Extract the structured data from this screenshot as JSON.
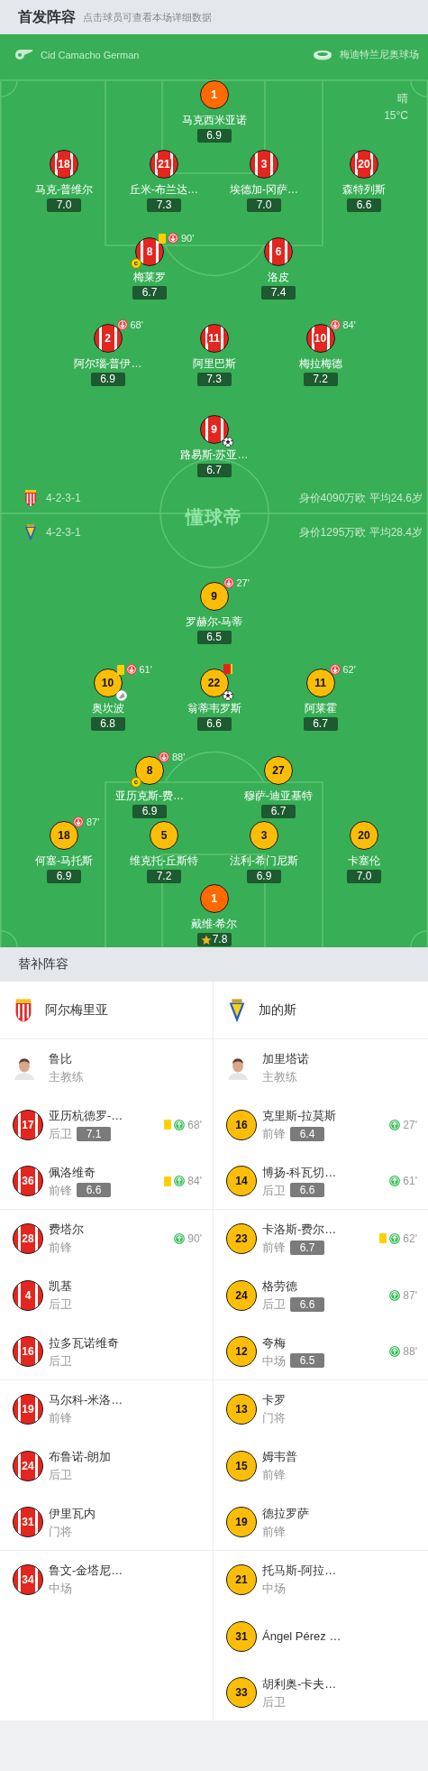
{
  "header": {
    "title": "首发阵容",
    "subtitle": "点击球员可查看本场详细数据"
  },
  "match": {
    "referee": "Cid Camacho German",
    "stadium": "梅迪特兰尼奥球场",
    "weather": "晴",
    "temperature": "15°C",
    "pitch_logo": "懂球帝"
  },
  "lineup": {
    "home": {
      "formation": "4-2-3-1",
      "value": "身价4090万欧 平均24.6岁",
      "rows": [
        [
          {
            "number": "1",
            "name": "马克西米亚诺",
            "rating": "6.9",
            "kind": "keeper",
            "yellow_card": false,
            "red_card": false,
            "goal": false,
            "assist": false,
            "mvp": false
          }
        ],
        [
          {
            "number": "18",
            "name": "马克-普维尔",
            "rating": "7.0",
            "kind": "outfield",
            "yellow_card": false,
            "red_card": false,
            "goal": false,
            "assist": false,
            "mvp": false
          },
          {
            "number": "21",
            "name": "丘米-布兰达…",
            "rating": "7.3",
            "kind": "outfield",
            "yellow_card": false,
            "red_card": false,
            "goal": false,
            "assist": false,
            "mvp": false
          },
          {
            "number": "3",
            "name": "埃德加-冈萨…",
            "rating": "7.0",
            "kind": "outfield",
            "yellow_card": false,
            "red_card": false,
            "goal": false,
            "assist": false,
            "mvp": false
          },
          {
            "number": "20",
            "name": "森特列斯",
            "rating": "6.6",
            "kind": "outfield",
            "yellow_card": false,
            "red_card": false,
            "goal": false,
            "assist": false,
            "mvp": false
          }
        ],
        [
          {
            "number": "8",
            "name": "梅莱罗",
            "rating": "6.7",
            "kind": "outfield",
            "yellow_card": true,
            "red_card": false,
            "goal": false,
            "assist": false,
            "mvp": false,
            "captain": "c",
            "sub_off": "90'"
          },
          {
            "number": "6",
            "name": "洛皮",
            "rating": "7.4",
            "kind": "outfield",
            "yellow_card": false,
            "red_card": false,
            "goal": false,
            "assist": false,
            "mvp": false
          }
        ],
        [
          {
            "number": "2",
            "name": "阿尔瑙-普伊…",
            "rating": "6.9",
            "kind": "outfield",
            "yellow_card": false,
            "red_card": false,
            "goal": false,
            "assist": false,
            "mvp": false,
            "sub_off": "68'"
          },
          {
            "number": "11",
            "name": "阿里巴斯",
            "rating": "7.3",
            "kind": "outfield",
            "yellow_card": false,
            "red_card": false,
            "goal": false,
            "assist": false,
            "mvp": false
          },
          {
            "number": "10",
            "name": "梅拉梅德",
            "rating": "7.2",
            "kind": "outfield",
            "yellow_card": false,
            "red_card": false,
            "goal": false,
            "assist": false,
            "mvp": false,
            "sub_off": "84'"
          }
        ],
        [
          {
            "number": "9",
            "name": "路易斯-苏亚…",
            "rating": "6.7",
            "kind": "outfield",
            "yellow_card": false,
            "red_card": false,
            "goal": true,
            "assist": false,
            "mvp": false
          }
        ]
      ]
    },
    "away": {
      "formation": "4-2-3-1",
      "value": "身价1295万欧 平均28.4岁",
      "rows": [
        [
          {
            "number": "9",
            "name": "罗赫尔-马蒂",
            "rating": "6.5",
            "kind": "outfield",
            "yellow_card": false,
            "red_card": false,
            "goal": false,
            "assist": false,
            "mvp": false,
            "sub_off": "27'"
          }
        ],
        [
          {
            "number": "10",
            "name": "奥坎波",
            "rating": "6.8",
            "kind": "outfield",
            "yellow_card": true,
            "red_card": false,
            "goal": false,
            "assist": true,
            "mvp": false,
            "sub_off": "61'"
          },
          {
            "number": "22",
            "name": "翁蒂韦罗斯",
            "rating": "6.6",
            "kind": "outfield",
            "yellow_card": false,
            "red_card": true,
            "goal": true,
            "assist": false,
            "mvp": false
          },
          {
            "number": "11",
            "name": "阿莱霍",
            "rating": "6.7",
            "kind": "outfield",
            "yellow_card": false,
            "red_card": false,
            "goal": false,
            "assist": false,
            "mvp": false,
            "sub_off": "62'"
          }
        ],
        [
          {
            "number": "8",
            "name": "亚历克斯-费…",
            "rating": "6.9",
            "kind": "outfield",
            "yellow_card": false,
            "red_card": false,
            "goal": false,
            "assist": false,
            "mvp": false,
            "captain": "c",
            "sub_off": "88'"
          },
          {
            "number": "27",
            "name": "穆萨-迪亚基特",
            "rating": "6.7",
            "kind": "outfield",
            "yellow_card": false,
            "red_card": false,
            "goal": false,
            "assist": false,
            "mvp": false
          }
        ],
        [
          {
            "number": "18",
            "name": "何塞-马托斯",
            "rating": "6.9",
            "kind": "outfield",
            "yellow_card": false,
            "red_card": false,
            "goal": false,
            "assist": false,
            "mvp": false,
            "sub_off": "87'"
          },
          {
            "number": "5",
            "name": "维克托-丘斯特",
            "rating": "7.2",
            "kind": "outfield",
            "yellow_card": false,
            "red_card": false,
            "goal": false,
            "assist": false,
            "mvp": false
          },
          {
            "number": "3",
            "name": "法利-希门尼斯",
            "rating": "6.9",
            "kind": "outfield",
            "yellow_card": false,
            "red_card": false,
            "goal": false,
            "assist": false,
            "mvp": false
          },
          {
            "number": "20",
            "name": "卡塞伦",
            "rating": "7.0",
            "kind": "outfield",
            "yellow_card": false,
            "red_card": false,
            "goal": false,
            "assist": false,
            "mvp": false
          }
        ],
        [
          {
            "number": "1",
            "name": "戴维-希尔",
            "rating": "7.8",
            "kind": "keeper",
            "yellow_card": false,
            "red_card": false,
            "goal": false,
            "assist": false,
            "mvp": true
          }
        ]
      ]
    }
  },
  "substitutes": {
    "title": "替补阵容",
    "home": {
      "team": "阿尔梅里亚",
      "coach": {
        "name": "鲁比",
        "role": "主教练"
      },
      "players": [
        {
          "number": "17",
          "name": "亚历杭德罗-…",
          "position": "后卫",
          "rating": "7.1",
          "yellow_card": true,
          "sub_on": "68'"
        },
        {
          "number": "36",
          "name": "佩洛维奇",
          "position": "前锋",
          "rating": "6.6",
          "yellow_card": true,
          "sub_on": "84'"
        },
        {
          "number": "28",
          "name": "费塔尔",
          "position": "前锋",
          "yellow_card": false,
          "sub_on": "90'"
        },
        {
          "number": "4",
          "name": "凯基",
          "position": "后卫",
          "yellow_card": false
        },
        {
          "number": "16",
          "name": "拉多瓦诺维奇",
          "position": "后卫",
          "yellow_card": false
        },
        {
          "number": "19",
          "name": "马尔科-米洛…",
          "position": "前锋",
          "yellow_card": false
        },
        {
          "number": "24",
          "name": "布鲁诺-朗加",
          "position": "后卫",
          "yellow_card": false
        },
        {
          "number": "31",
          "name": "伊里瓦内",
          "position": "门将",
          "yellow_card": false
        },
        {
          "number": "34",
          "name": "鲁文-金塔尼…",
          "position": "中场",
          "yellow_card": false
        }
      ]
    },
    "away": {
      "team": "加的斯",
      "coach": {
        "name": "加里塔诺",
        "role": "主教练"
      },
      "players": [
        {
          "number": "16",
          "name": "克里斯-拉莫斯",
          "position": "前锋",
          "rating": "6.4",
          "yellow_card": false,
          "sub_on": "27'"
        },
        {
          "number": "14",
          "name": "博扬-科瓦切…",
          "position": "后卫",
          "rating": "6.6",
          "yellow_card": false,
          "sub_on": "61'"
        },
        {
          "number": "23",
          "name": "卡洛斯-费尔…",
          "position": "前锋",
          "rating": "6.7",
          "yellow_card": true,
          "sub_on": "62'"
        },
        {
          "number": "24",
          "name": "格劳德",
          "position": "后卫",
          "rating": "6.6",
          "yellow_card": false,
          "sub_on": "87'"
        },
        {
          "number": "12",
          "name": "夸梅",
          "position": "中场",
          "rating": "6.5",
          "yellow_card": false,
          "sub_on": "88'"
        },
        {
          "number": "13",
          "name": "卡罗",
          "position": "门将",
          "yellow_card": false
        },
        {
          "number": "15",
          "name": "姆韦普",
          "position": "前锋",
          "yellow_card": false
        },
        {
          "number": "19",
          "name": "德拉罗萨",
          "position": "前锋",
          "yellow_card": false
        },
        {
          "number": "21",
          "name": "托马斯-阿拉…",
          "position": "中场",
          "yellow_card": false
        },
        {
          "number": "31",
          "name": "Ángel Pérez …",
          "yellow_card": false
        },
        {
          "number": "33",
          "name": "胡利奥-卡夫…",
          "position": "后卫",
          "yellow_card": false
        }
      ]
    }
  }
}
